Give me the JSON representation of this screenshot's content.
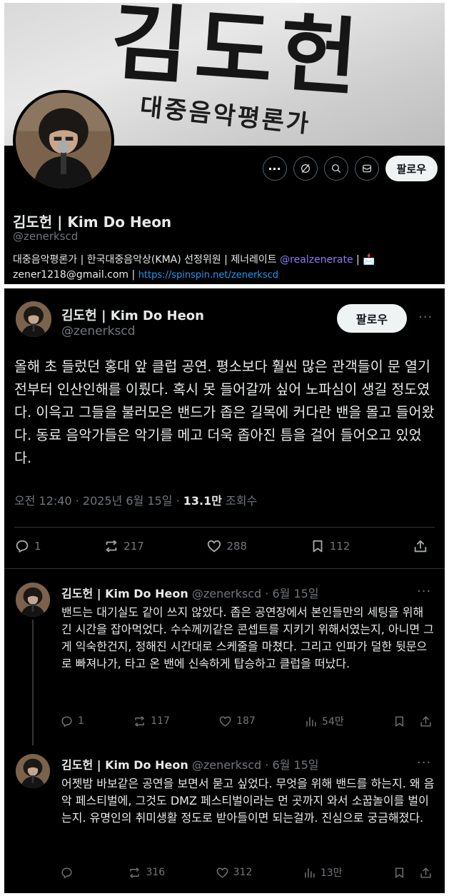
{
  "profile": {
    "banner_title": "김도헌",
    "banner_subtitle": "대중음악평론가",
    "name": "김도헌 | Kim Do Heon",
    "handle": "@zenerkscd",
    "follow_label": "팔로우",
    "more_label": "···",
    "bio_text": "대중음악평론가 | 한국대중음악상(KMA) 선정위원 | 제너레이트 ",
    "bio_mention": "@realzenerate",
    "bio_sep": " | ",
    "bio_email": "zener1218@gmail.com | ",
    "bio_link": "https://spinspin.net/zenerkscd"
  },
  "main_tweet": {
    "name": "김도헌 | Kim Do Heon",
    "handle": "@zenerkscd",
    "follow_label": "팔로우",
    "more": "···",
    "text": "올해 초 들렀던 홍대 앞 클럽 공연. 평소보다 훨씬 많은 관객들이 문 열기 전부터 인산인해를 이뤘다. 혹시 못 들어갈까 싶어 노파심이 생길 정도였다. 이윽고 그들을 불러모은 밴드가 좁은 길목에 커다란 밴을 몰고 들어왔다. 동료 음악가들은 악기를 메고 더욱 좁아진 틈을 걸어 들어오고 있었다.",
    "time": "오전 12:40 · 2025년 6월 15일 · ",
    "views_count": "13.1만",
    "views_label": " 조회수",
    "replies": "1",
    "reposts": "217",
    "likes": "288",
    "bookmarks": "112"
  },
  "replies": [
    {
      "name": "김도헌 | Kim Do Heon",
      "handle": "@zenerkscd · 6월 15일",
      "more": "···",
      "text": "밴드는 대기실도 같이 쓰지 않았다. 좁은 공연장에서 본인들만의 세팅을 위해 긴 시간을 잡아먹었다. 수수께끼같은 콘셉트를 지키기 위해서였는지, 아니면 그게 익숙한건지, 정해진 시간대로 스케줄을 마쳤다. 그리고 인파가 덜한 뒷문으로 빠져나가, 타고 온 밴에 신속하게 탑승하고 클럽을 떠났다.",
      "replies": "1",
      "reposts": "117",
      "likes": "187",
      "views": "54만"
    },
    {
      "name": "김도헌 | Kim Do Heon",
      "handle": "@zenerkscd · 6월 15일",
      "more": "···",
      "text": "어젯밤 바보같은 공연을 보면서 묻고 싶었다. 무엇을 위해 밴드를 하는지. 왜 음악 페스티벌에, 그것도 DMZ 페스티벌이라는 먼 곳까지 와서 소꿉놀이를 벌이는지. 유명인의 취미생활 정도로 받아들이면 되는걸까. 진심으로 궁금해졌다.",
      "replies": "",
      "reposts": "316",
      "likes": "312",
      "views": "13만"
    }
  ]
}
